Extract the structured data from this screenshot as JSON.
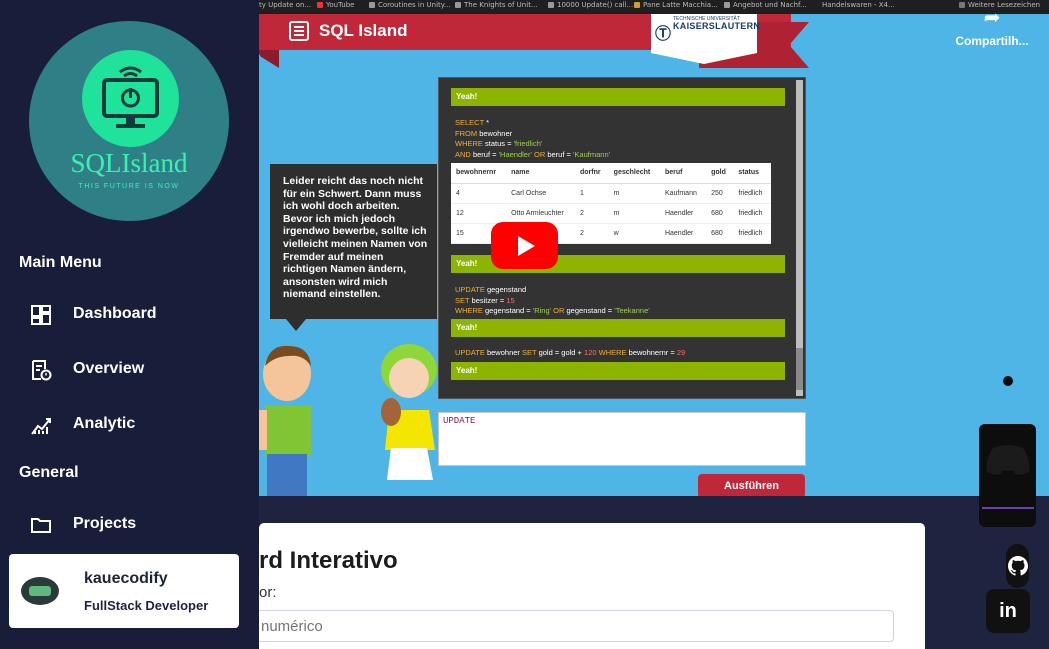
{
  "sidebar": {
    "logo_title": "SQLIsland",
    "logo_subtitle": "THIS FUTURE IS NOW",
    "section_main": "Main Menu",
    "section_general": "General",
    "items": [
      {
        "label": "Dashboard",
        "icon": "dashboard-icon"
      },
      {
        "label": "Overview",
        "icon": "overview-icon"
      },
      {
        "label": "Analytic",
        "icon": "analytic-icon"
      },
      {
        "label": "Projects",
        "icon": "folder-icon"
      }
    ],
    "profile": {
      "name": "kauecodify",
      "role": "FullStack Developer"
    }
  },
  "video": {
    "bookmarks": [
      "ty Update on...",
      "YouTube",
      "Coroutines in Unity...",
      "The Knights of Unit...",
      "10000 Update() call...",
      "Pane Latte Macchia...",
      "Angebot und Nachf...",
      "Handelswaren - X4...",
      "Weitere Lesezeichen"
    ],
    "share_label": "Compartilh...",
    "app_title": "SQL Island",
    "tu_small": "TECHNISCHE UNIVERSITÄT",
    "tu_big": "KAISERSLAUTERN",
    "speech": "Leider reicht das noch nicht für ein Schwert. Dann muss ich wohl doch arbeiten. Bevor ich mich jedoch irgendwo bewerbe, sollte ich vielleicht meinen Namen von Fremder auf meinen richtigen Namen ändern, ansonsten wird mich niemand einstellen.",
    "yeah": "Yeah!",
    "query1": {
      "select": "SELECT",
      "star": "*",
      "from": "FROM",
      "table": "bewohner",
      "where": "WHERE",
      "cond1": "status =",
      "val1": "'friedlich'",
      "and": "AND",
      "cond2": "beruf =",
      "val2": "'Haendler'",
      "or": "OR",
      "cond3": "beruf =",
      "val3": "'Kaufmann'"
    },
    "table": {
      "headers": [
        "bewohnernr",
        "name",
        "dorfnr",
        "geschlecht",
        "beruf",
        "gold",
        "status"
      ],
      "rows": [
        [
          "4",
          "Carl Ochse",
          "1",
          "m",
          "Kaufmann",
          "250",
          "friedlich"
        ],
        [
          "12",
          "Otto Armleuchter",
          "2",
          "m",
          "Haendler",
          "680",
          "friedlich"
        ],
        [
          "15",
          "opf",
          "2",
          "w",
          "Haendler",
          "680",
          "friedlich"
        ]
      ]
    },
    "query2": {
      "update": "UPDATE",
      "table": "gegenstand",
      "set": "SET",
      "col": "besitzer =",
      "num": "15",
      "where": "WHERE",
      "cond1": "gegenstand =",
      "val1": "'Ring'",
      "or": "OR",
      "cond2": "gegenstand =",
      "val2": "'Teekanne'"
    },
    "query3": {
      "update": "UPDATE",
      "table": "bewohner",
      "set": "SET",
      "col": "gold = gold +",
      "num": "120",
      "where": "WHERE",
      "cond": "bewohnernr =",
      "val": "29"
    },
    "input_value": "UPDATE",
    "run_label": "Ausführen"
  },
  "main": {
    "title": "rd Interativo",
    "label": "or:",
    "input_placeholder": "numérico"
  },
  "social": {
    "github": "github-icon",
    "linkedin_label": "in",
    "discord": "discord-icon"
  }
}
